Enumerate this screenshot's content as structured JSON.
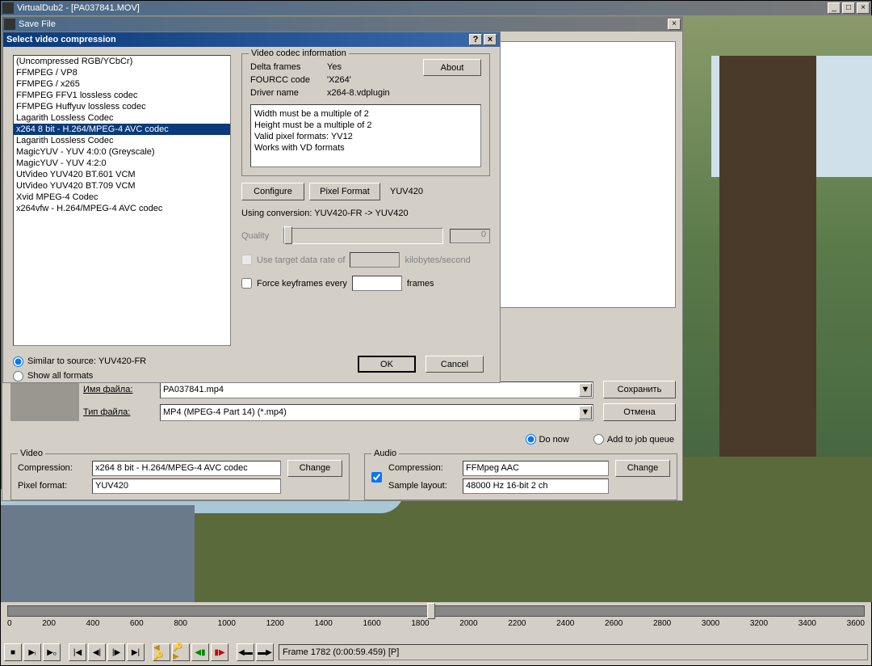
{
  "main_window": {
    "title": "VirtualDub2 - [PA037841.MOV]"
  },
  "save_dialog": {
    "title": "Save File",
    "filename_label": "Имя файла:",
    "filetype_label": "Тип файла:",
    "filename": "PA037841.mp4",
    "filetype": "MP4 (MPEG-4 Part 14) (*.mp4)",
    "save_btn": "Сохранить",
    "cancel_btn": "Отмена",
    "do_now": "Do now",
    "add_queue": "Add to job queue",
    "video_group": {
      "legend": "Video",
      "compression_label": "Compression:",
      "compression_value": "x264 8 bit - H.264/MPEG-4 AVC codec",
      "pixel_label": "Pixel format:",
      "pixel_value": "YUV420",
      "change": "Change"
    },
    "audio_group": {
      "legend": "Audio",
      "compression_label": "Compression:",
      "compression_value": "FFMpeg AAC",
      "sample_label": "Sample layout:",
      "sample_value": "48000 Hz 16-bit 2 ch",
      "change": "Change"
    }
  },
  "codec_dialog": {
    "title": "Select video compression",
    "codecs": [
      "(Uncompressed RGB/YCbCr)",
      "FFMPEG / VP8",
      "FFMPEG / x265",
      "FFMPEG FFV1 lossless codec",
      "FFMPEG Huffyuv lossless codec",
      "Lagarith Lossless Codec",
      "x264 8 bit - H.264/MPEG-4 AVC codec",
      "Lagarith Lossless Codec",
      "MagicYUV - YUV 4:0:0 (Greyscale)",
      "MagicYUV - YUV 4:2:0",
      "UtVideo YUV420 BT.601 VCM",
      "UtVideo YUV420 BT.709 VCM",
      "Xvid MPEG-4 Codec",
      "x264vfw - H.264/MPEG-4 AVC codec"
    ],
    "selected_index": 6,
    "info": {
      "legend": "Video codec information",
      "delta_label": "Delta frames",
      "delta_value": "Yes",
      "fourcc_label": "FOURCC code",
      "fourcc_value": "'X264'",
      "driver_label": "Driver name",
      "driver_value": "x264-8.vdplugin",
      "about": "About",
      "description": [
        "Width must be a multiple of 2",
        "Height must be a multiple of 2",
        "Valid pixel formats: YV12",
        "Works with VD formats"
      ]
    },
    "configure": "Configure",
    "pixel_format": "Pixel Format",
    "pixel_format_value": "YUV420",
    "conversion": "Using conversion: YUV420-FR -> YUV420",
    "quality_label": "Quality",
    "quality_value": "0",
    "target_rate": "Use target data rate of",
    "target_unit": "kilobytes/second",
    "force_kf": "Force keyframes every",
    "force_unit": "frames",
    "similar": "Similar to source: YUV420-FR",
    "show_all": "Show all formats",
    "ok": "OK",
    "cancel": "Cancel"
  },
  "timeline": {
    "ticks": [
      "0",
      "200",
      "400",
      "600",
      "800",
      "1000",
      "1200",
      "1400",
      "1600",
      "1800",
      "2000",
      "2200",
      "2400",
      "2600",
      "2800",
      "3000",
      "3200",
      "3400",
      "3600"
    ]
  },
  "frame_info": "Frame 1782 (0:00:59.459) [P]"
}
